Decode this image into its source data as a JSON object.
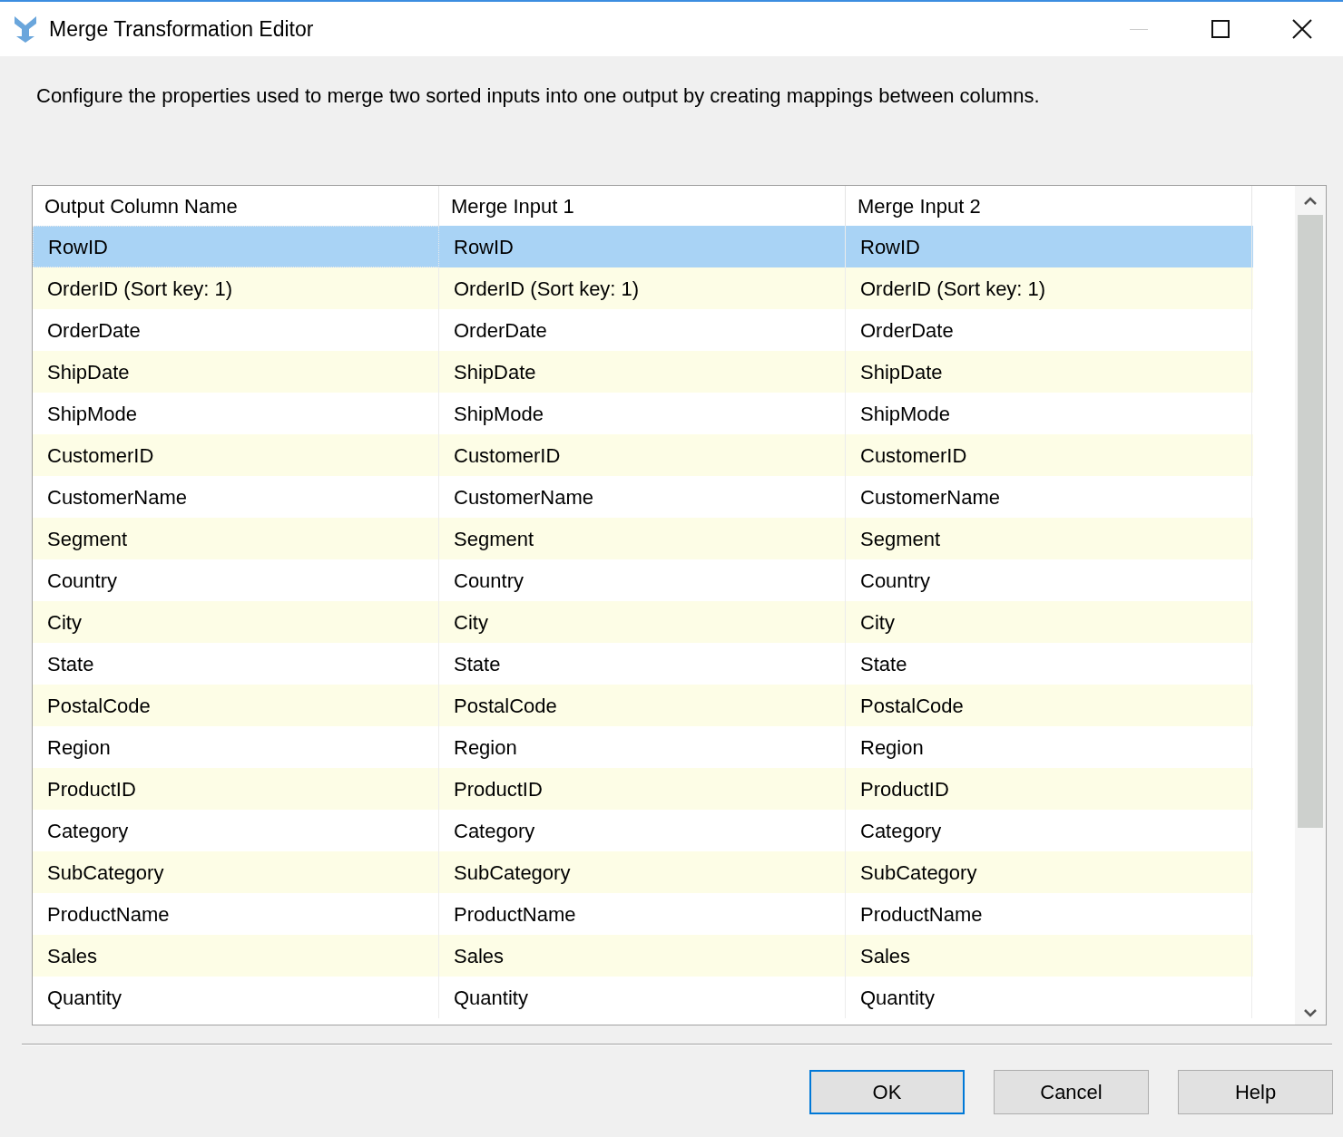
{
  "window": {
    "title": "Merge Transformation Editor"
  },
  "description": "Configure the properties used to merge two sorted inputs into one output by creating mappings between columns.",
  "table": {
    "columns": [
      "Output Column Name",
      "Merge Input 1",
      "Merge Input 2"
    ],
    "rows": [
      {
        "cells": [
          "RowID",
          "RowID",
          "RowID"
        ],
        "selected": true
      },
      {
        "cells": [
          "OrderID (Sort key: 1)",
          "OrderID (Sort key: 1)",
          "OrderID (Sort key: 1)"
        ],
        "selected": false
      },
      {
        "cells": [
          "OrderDate",
          "OrderDate",
          "OrderDate"
        ],
        "selected": false
      },
      {
        "cells": [
          "ShipDate",
          "ShipDate",
          "ShipDate"
        ],
        "selected": false
      },
      {
        "cells": [
          "ShipMode",
          "ShipMode",
          "ShipMode"
        ],
        "selected": false
      },
      {
        "cells": [
          "CustomerID",
          "CustomerID",
          "CustomerID"
        ],
        "selected": false
      },
      {
        "cells": [
          "CustomerName",
          "CustomerName",
          "CustomerName"
        ],
        "selected": false
      },
      {
        "cells": [
          "Segment",
          "Segment",
          "Segment"
        ],
        "selected": false
      },
      {
        "cells": [
          "Country",
          "Country",
          "Country"
        ],
        "selected": false
      },
      {
        "cells": [
          "City",
          "City",
          "City"
        ],
        "selected": false
      },
      {
        "cells": [
          "State",
          "State",
          "State"
        ],
        "selected": false
      },
      {
        "cells": [
          "PostalCode",
          "PostalCode",
          "PostalCode"
        ],
        "selected": false
      },
      {
        "cells": [
          "Region",
          "Region",
          "Region"
        ],
        "selected": false
      },
      {
        "cells": [
          "ProductID",
          "ProductID",
          "ProductID"
        ],
        "selected": false
      },
      {
        "cells": [
          "Category",
          "Category",
          "Category"
        ],
        "selected": false
      },
      {
        "cells": [
          "SubCategory",
          "SubCategory",
          "SubCategory"
        ],
        "selected": false
      },
      {
        "cells": [
          "ProductName",
          "ProductName",
          "ProductName"
        ],
        "selected": false
      },
      {
        "cells": [
          "Sales",
          "Sales",
          "Sales"
        ],
        "selected": false
      },
      {
        "cells": [
          "Quantity",
          "Quantity",
          "Quantity"
        ],
        "selected": false
      }
    ]
  },
  "buttons": [
    {
      "label": "OK",
      "default": true
    },
    {
      "label": "Cancel",
      "default": false
    },
    {
      "label": "Help",
      "default": false
    }
  ]
}
